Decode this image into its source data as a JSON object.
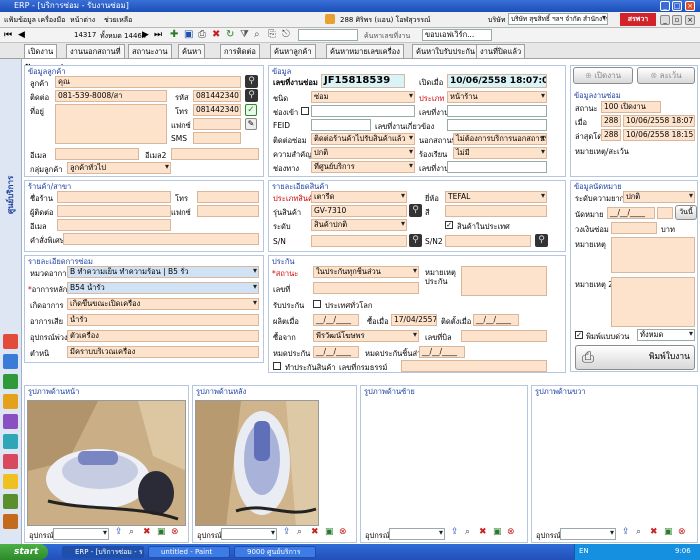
{
  "window": {
    "title": "ERP - [บริการซ่อม - รับงานซ่อม]"
  },
  "menubar": {
    "items": [
      "แฟ้มข้อมูล",
      "เครื่องมือ",
      "หน้าต่าง",
      "ช่วยเหลือ"
    ],
    "user": "288 ศิริพร (แอน) โอฬสุวรรณ์",
    "company_label": "บริษัท",
    "company": "บริษัท สุขสิทธิ์ ฯลฯ จำกัด สำนักงานใหญ่"
  },
  "toolbar": {
    "count": "14317",
    "record_label": "ทั้งหมด 14464",
    "search_placeholder": "ค้นหาเลขที่งาน",
    "search_value": "ขอบเอฟเวิร์ก..."
  },
  "tabs": [
    "เปิดงาน",
    "งานนอกสถานที่",
    "สถานะงาน",
    "ค้นหา",
    "การติดต่อ",
    "ค้นหาลูกค้า",
    "ค้นหาหมายเลขเครื่อง",
    "ค้นหาใบรับประกัน",
    "งานที่ปิดแล้ว"
  ],
  "page": {
    "title": "รับงานซ่อม"
  },
  "customer": {
    "section": "ข้อมูลลูกค้า",
    "name_label": "ลูกค้า",
    "name": "คุณ",
    "contact_label": "ติดต่อ",
    "contact": "081-539-8008/สา",
    "code_label": "รหัส",
    "code": "0814423401",
    "address_label": "ที่อยู่",
    "phone_label": "โทร",
    "phone": "0814423401",
    "fax_label": "แฟกซ์",
    "sms_label": "SMS",
    "email_label": "อีเมล",
    "email2_label": "อีเมล2",
    "group_label": "กลุ่มลูกค้า",
    "group": "ลูกค้าทั่วไป"
  },
  "info": {
    "section": "ข้อมูล",
    "job_no_label": "เลขที่งานซ่อม",
    "job_no": "JF15818539",
    "open_label": "เปิดเมื่อ",
    "open_date": "10/06/2558 18:07:09",
    "type_label": "ชนิด",
    "type": "ซ่อม",
    "category_label": "ประเภท",
    "category": "หน้าร้าน",
    "channel_label": "ช่องเข้า",
    "job_label": "เลขที่งาน",
    "feid_label": "FEID",
    "ref_label": "เลขที่งานเกี่ยวข้อง",
    "contact_repair_label": "ติดต่อซ่อม",
    "contact_repair": "ติดต่อร้านค้าไปรับสินค้าแล้ว",
    "outside_label": "นอกสถานที่",
    "outside": "ไม่ต้องการบริการนอกสถานที่",
    "priority_label": "ความสำคัญ",
    "priority": "ปกติ",
    "complaint_label": "ร้องเรียน",
    "complaint": "ไม่มี",
    "via_label": "ช่องทาง",
    "via": "ที่ศูนย์บริการ",
    "job2_label": "เลขที่งาน"
  },
  "status": {
    "section": "ข้อมูลงานซ่อม",
    "state_label": "สถานะ",
    "state": "100 เปิดงาน",
    "when_label": "เมื่อ",
    "when_user": "288",
    "when_date": "10/06/2558 18:07",
    "last_label": "ล่าสุดโดย",
    "last_user": "288",
    "last_date": "10/06/2558 18:15",
    "note_label": "หมายเหตุ/สะเว้น",
    "open_btn": "เปิดงาน",
    "cancel_btn": "ละเว้น"
  },
  "shop": {
    "section": "ร้านค้า/สาขา",
    "name_label": "ชื่อร้าน",
    "phone_label": "โทร",
    "contact_label": "ผู้ติดต่อ",
    "fax_label": "แฟกซ์",
    "email_label": "อีเมล",
    "special_label": "คำสั่งพิเศษ"
  },
  "product": {
    "section": "รายละเอียดสินค้า",
    "type_label": "ประเภทสินค้า",
    "type": "เตารีด",
    "brand_label": "ยี่ห้อ",
    "brand": "TEFAL",
    "model_label": "รุ่นสินค้า",
    "model": "GV-7310",
    "color_label": "สี",
    "level_label": "ระดับ",
    "level": "สินค้าปกติ",
    "domestic_label": "สินค้าในประเทศ",
    "sn_label": "S/N",
    "sn2_label": "S/N2"
  },
  "appointment": {
    "section": "ข้อมูลนัดหมาย",
    "urgency_label": "ระดับความยาก",
    "urgency": "ปกติ",
    "date_label": "นัดหมาย",
    "date_value": "__/__/____",
    "day_btn": "วันนี้",
    "deposit_label": "วงเงินซ่อม",
    "deposit_unit": "บาท",
    "note1_label": "หมายเหตุ",
    "note2_label": "หมายเหตุ 2",
    "print_label": "พิมพ์แบบด่วน",
    "print_mode": "ทั้งหมด",
    "print_btn": "พิมพ์ใบงาน"
  },
  "repair": {
    "section": "รายละเอียดการซ่อม",
    "group_label": "หมวดอาการ",
    "group": "B ทำความเย็น ทำความร้อน | B5 รั่ว",
    "symptom_label": "อาการหลัก",
    "symptom": "B54 น้ำรั่ว",
    "cause_label": "เกิดอาการ",
    "cause": "เกิดขึ้นขณะเปิดเครื่อง",
    "detail_label": "อาการเสีย",
    "detail": "น้ำรั่ว",
    "parts_label": "อุปกรณ์พ่วง",
    "parts": "ตัวเครื่อง",
    "flaw_label": "ตำหนิ",
    "flaw": "มีคราบบริเวณเครื่อง"
  },
  "warranty": {
    "section": "ประกัน",
    "status_label": "สถานะ",
    "status": "ในประกันทุกชิ้นส่วน",
    "note_label": "หมายเหตุประกัน",
    "number_label": "เลขที่",
    "global_label": "รับประกัน",
    "global_check": "ประเทศทั่วโลก",
    "mfg_label": "ผลิตเมื่อ",
    "buy_label": "ซื้อเมื่อ",
    "buy_date": "17/04/2557",
    "install_label": "ติดตั้งเมื่อ",
    "from_label": "ซื้อจาก",
    "from": "พีรวัฒน์โฆษพร",
    "bill_label": "เลขที่บิล",
    "expire_label": "หมดประกัน",
    "parts_expire_label": "หมดประกันชิ้นส่วน",
    "card_label": "ทำประกันสินค้า",
    "card_no_label": "เลขที่กรมธรรม์"
  },
  "photos": [
    "รูปภาพด้านหน้า",
    "รูปภาพด้านหลัง",
    "รูปภาพด้านซ้าย",
    "รูปภาพด้านขวา"
  ],
  "photo_label": "อุปกรณ์",
  "sidebar_label": "ศูนย์บริการ",
  "taskbar": {
    "start": "start",
    "items": [
      "ERP - [บริการซ่อม - ร...",
      "untitled - Paint",
      "9000 ศูนย์บริการ"
    ],
    "lang": "EN",
    "clock": "9:06"
  }
}
